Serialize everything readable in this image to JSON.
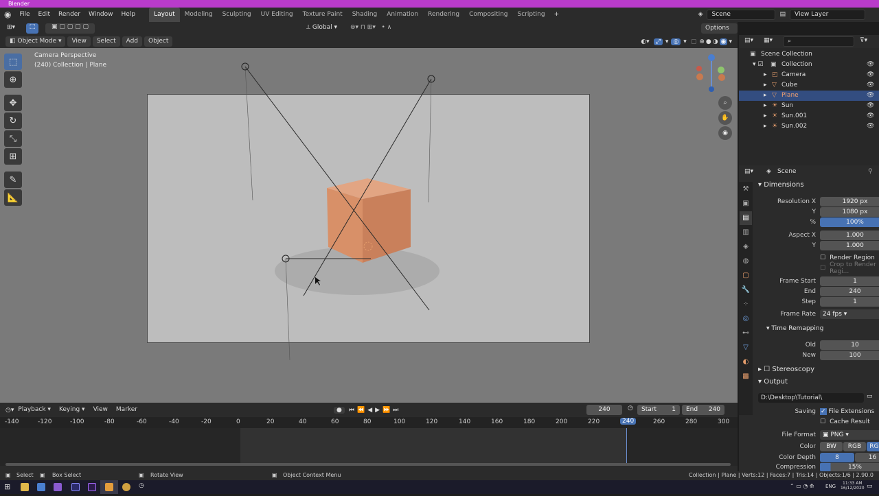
{
  "app": {
    "title": "Blender"
  },
  "menu": [
    "File",
    "Edit",
    "Render",
    "Window",
    "Help"
  ],
  "workspaces": [
    "Layout",
    "Modeling",
    "Sculpting",
    "UV Editing",
    "Texture Paint",
    "Shading",
    "Animation",
    "Rendering",
    "Compositing",
    "Scripting"
  ],
  "active_workspace": "Layout",
  "scene": {
    "label": "Scene",
    "view_layer": "View Layer"
  },
  "tool_header": {
    "orientation": "Global",
    "options": "Options"
  },
  "viewport_header": {
    "mode": "Object Mode",
    "view": "View",
    "select": "Select",
    "add": "Add",
    "object": "Object"
  },
  "viewport_overlay": {
    "line1": "Camera Perspective",
    "line2": "(240) Collection | Plane"
  },
  "outliner": {
    "root": "Scene Collection",
    "items": [
      "Collection",
      "Camera",
      "Cube",
      "Plane",
      "Sun",
      "Sun.001",
      "Sun.002"
    ],
    "selected": "Plane"
  },
  "properties": {
    "context": "Scene",
    "dimensions_title": "Dimensions",
    "res_x_label": "Resolution X",
    "res_x": "1920 px",
    "res_y_label": "Y",
    "res_y": "1080 px",
    "pct_label": "%",
    "pct": "100%",
    "aspect_x_label": "Aspect X",
    "aspect_x": "1.000",
    "aspect_y_label": "Y",
    "aspect_y": "1.000",
    "render_region": "Render Region",
    "crop_region": "Crop to Render Regi...",
    "frame_start_label": "Frame Start",
    "frame_start": "1",
    "end_label": "End",
    "end": "240",
    "step_label": "Step",
    "step": "1",
    "frame_rate_label": "Frame Rate",
    "frame_rate": "24 fps",
    "time_remap_title": "Time Remapping",
    "old_label": "Old",
    "old": "10",
    "new_label": "New",
    "new": "100",
    "stereoscopy": "Stereoscopy",
    "output_title": "Output",
    "output_path": "D:\\Desktop\\Tutorial\\",
    "saving_label": "Saving",
    "file_ext": "File Extensions",
    "cache_result": "Cache Result",
    "file_format_label": "File Format",
    "file_format": "PNG",
    "color_label": "Color",
    "color_bw": "BW",
    "color_rgb": "RGB",
    "color_rgba": "RGBA",
    "depth_label": "Color Depth",
    "depth_8": "8",
    "depth_16": "16",
    "compression_label": "Compression",
    "compression": "15%"
  },
  "timeline": {
    "playback": "Playback",
    "keying": "Keying",
    "view": "View",
    "marker": "Marker",
    "current": "240",
    "start_label": "Start",
    "start": "1",
    "end_label": "End",
    "end": "240",
    "ruler": [
      "-140",
      "-120",
      "-100",
      "-80",
      "-60",
      "-40",
      "-20",
      "0",
      "20",
      "40",
      "60",
      "80",
      "100",
      "120",
      "140",
      "160",
      "180",
      "200",
      "220",
      "240",
      "260",
      "280",
      "300"
    ]
  },
  "statusbar": {
    "select": "Select",
    "box_select": "Box Select",
    "rotate": "Rotate View",
    "context_menu": "Object Context Menu",
    "stats": "Collection | Plane | Verts:12 | Faces:7 | Tris:14 | Objects:1/6 | 2.90.0"
  },
  "taskbar": {
    "time": "11:33 AM",
    "date": "16/12/2020",
    "lang": "ENG"
  },
  "colors": {
    "accent": "#4772b3",
    "selection": "#334d80",
    "cube": "#d6916c",
    "titlebar": "#b93bcb"
  }
}
